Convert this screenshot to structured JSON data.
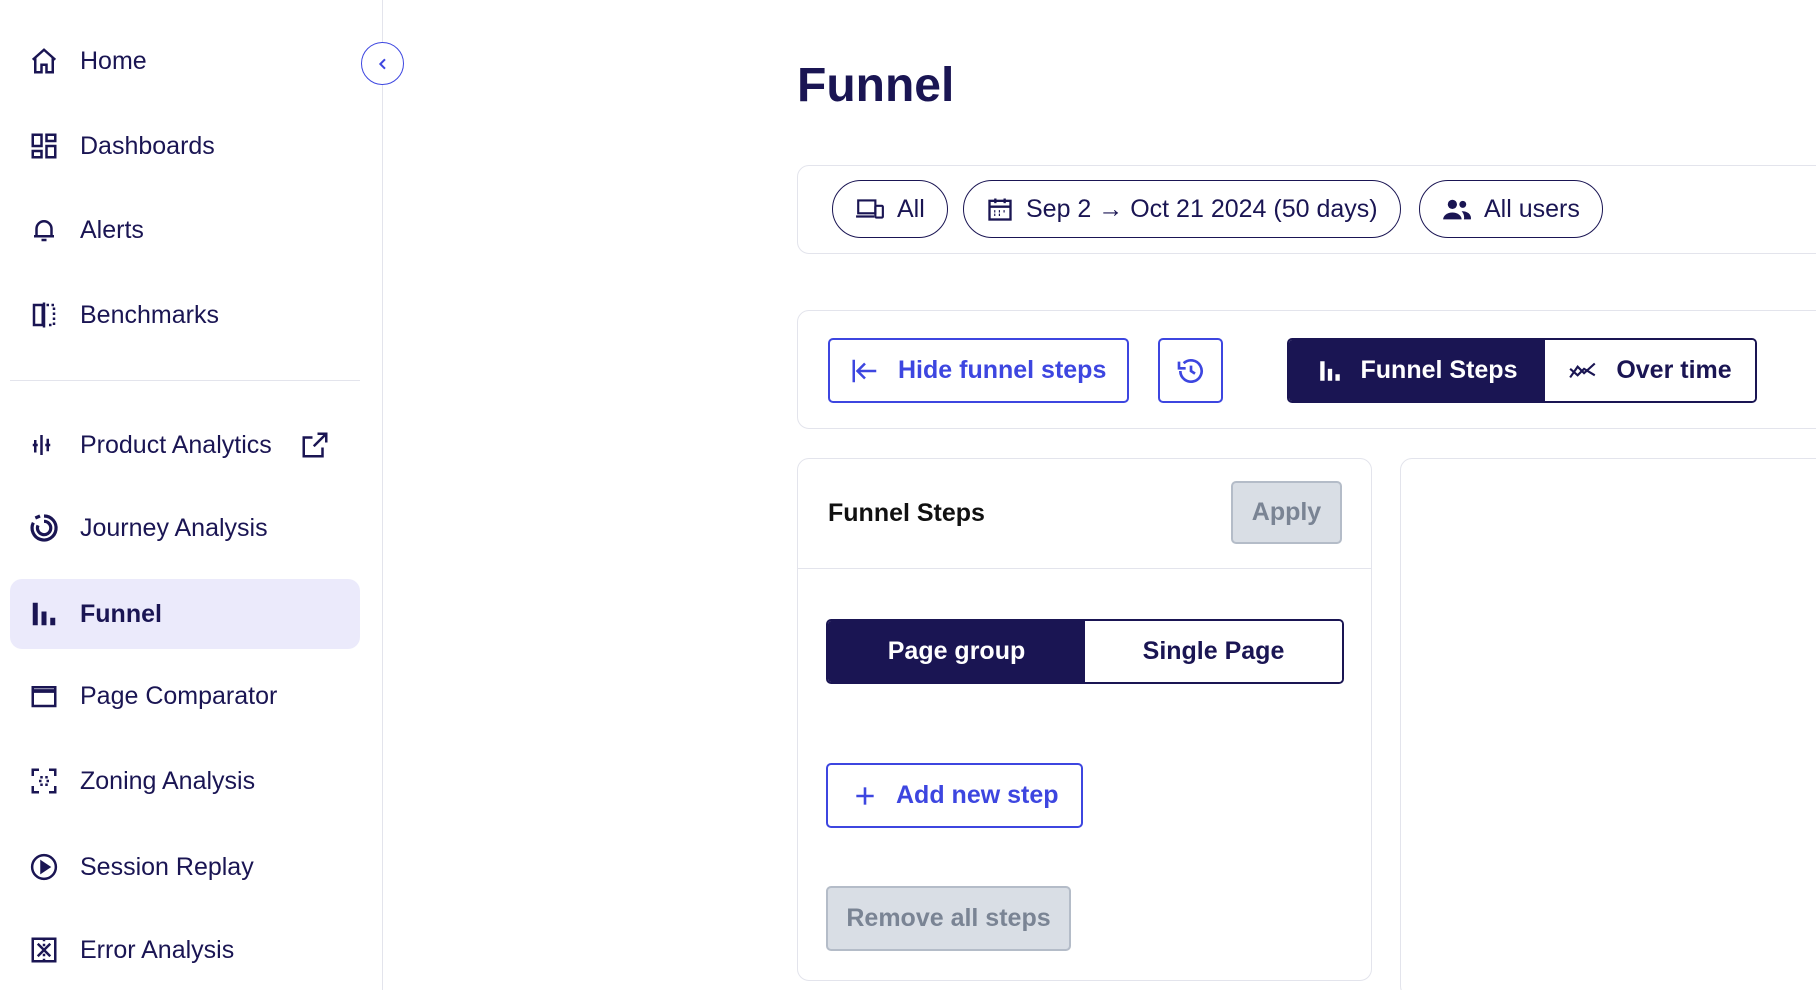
{
  "sidebar": {
    "items": [
      {
        "label": "Home",
        "icon": "home-icon"
      },
      {
        "label": "Dashboards",
        "icon": "dashboard-icon"
      },
      {
        "label": "Alerts",
        "icon": "bell-icon"
      },
      {
        "label": "Benchmarks",
        "icon": "benchmark-icon"
      },
      {
        "label": "Product Analytics",
        "icon": "product-analytics-icon",
        "external_icon": "external-link-icon"
      },
      {
        "label": "Journey Analysis",
        "icon": "journey-icon"
      },
      {
        "label": "Funnel",
        "icon": "funnel-icon",
        "active": true
      },
      {
        "label": "Page Comparator",
        "icon": "page-comparator-icon"
      },
      {
        "label": "Zoning Analysis",
        "icon": "zoning-icon"
      },
      {
        "label": "Session Replay",
        "icon": "play-icon"
      },
      {
        "label": "Error Analysis",
        "icon": "error-analysis-icon"
      }
    ]
  },
  "page": {
    "title": "Funnel"
  },
  "filters": {
    "device": "All",
    "date_range": "Sep 2 → Oct 21 2024 (50 days)",
    "segment": "All users"
  },
  "toolbar": {
    "hide_steps_label": "Hide funnel steps",
    "view_toggle": {
      "selected": "Funnel Steps",
      "other": "Over time"
    }
  },
  "steps_panel": {
    "title": "Funnel Steps",
    "apply_label": "Apply",
    "mode_toggle": {
      "selected": "Page group",
      "other": "Single Page"
    },
    "add_step_label": "Add new step",
    "remove_all_label": "Remove all steps"
  },
  "colors": {
    "navy": "#1a1553",
    "accent": "#3d46e0",
    "active_bg": "#ebeafb",
    "disabled_bg": "#d9dee5"
  }
}
